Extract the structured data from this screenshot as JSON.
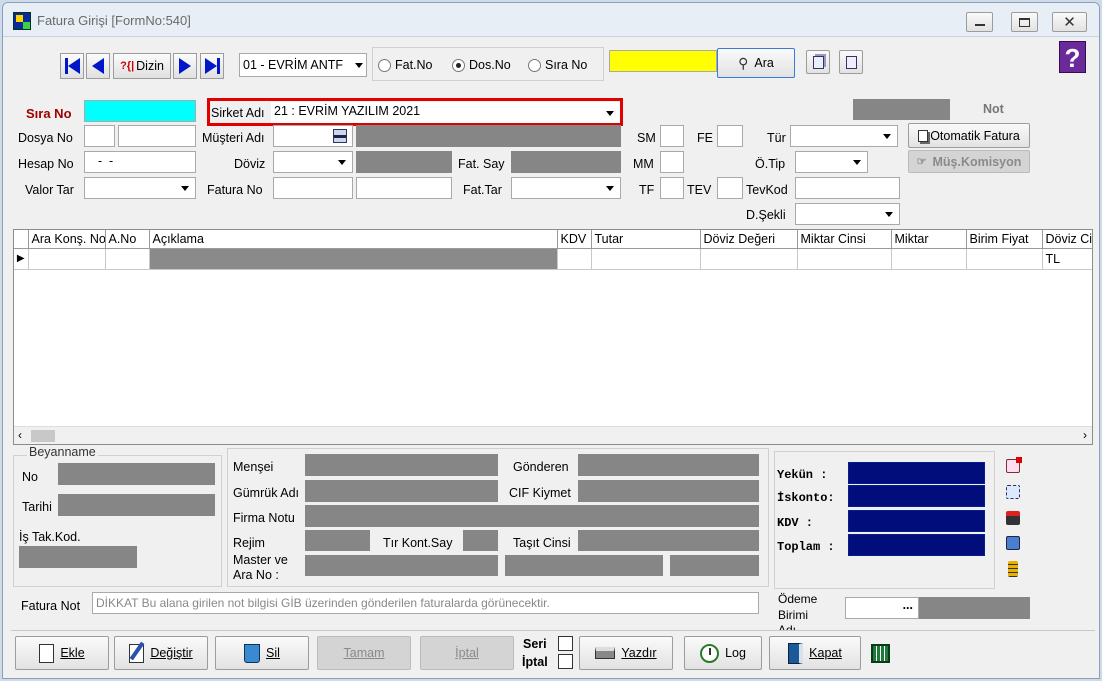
{
  "title": "Fatura Girişi [FormNo:540]",
  "nav": {
    "dizin": "Dizin",
    "company_select": "01 - EVRİM ANTF",
    "radio_fatno": "Fat.No",
    "radio_dosno": "Dos.No",
    "radio_sirano": "Sıra No",
    "ara": "Ara",
    "selected_radio": "Dos.No"
  },
  "header": {
    "sira_no": "Sıra No",
    "sirket_adi": "Sirket Adı",
    "sirket_value": "21 : EVRİM YAZILIM  2021",
    "not": "Not",
    "dosya_no": "Dosya No",
    "musteri_adi": "Müşteri Adı",
    "sm": "SM",
    "fe": "FE",
    "tur": "Tür",
    "otomatik_fatura": "Otomatik Fatura",
    "hesap_no": "Hesap No",
    "hesap_no_value": "  -  -  ",
    "doviz": "Döviz",
    "fat_say": "Fat. Say",
    "mm": "MM",
    "o_tip": "Ö.Tip",
    "mus_komisyon": "Müş.Komisyon",
    "valor_tar": "Valor Tar",
    "fatura_no": "Fatura No",
    "fat_tar": "Fat.Tar",
    "tf": "TF",
    "tev": "TEV",
    "tevkod": "TevKod",
    "d_sekli": "D.Şekli"
  },
  "grid": {
    "columns": [
      "Ara Konş. No",
      "A.No",
      "Açıklama",
      "KDV",
      "Tutar",
      "Döviz Değeri",
      "Miktar Cinsi",
      "Miktar",
      "Birim Fiyat",
      "Döviz Ci"
    ],
    "row": {
      "doviz": "TL"
    }
  },
  "beyanname": {
    "title": "Beyanname",
    "no": "No",
    "tarihi": "Tarihi",
    "is_tak_kod": "İş Tak.Kod."
  },
  "details": {
    "mensei": "Menşei",
    "gonderen": "Gönderen",
    "gumruk_adi": "Gümrük Adı",
    "cif_kiymet": "CIF Kiymet",
    "firma_notu": "Firma Notu",
    "rejim": "Rejim",
    "tir_kont_say": "Tır Kont.Say",
    "tasit_cinsi": "Taşıt Cinsi",
    "master_ve": "Master ve",
    "ara_no": "Ara No :"
  },
  "totals": {
    "yekun": "Yekün  :",
    "iskonto": "İskonto:",
    "kdv": "KDV    :",
    "toplam": "Toplam :"
  },
  "fatura_not": {
    "label": "Fatura Not",
    "value": "DİKKAT Bu alana girilen not bilgisi GİB üzerinden gönderilen faturalarda görünecektir."
  },
  "odeme": {
    "line1": "Ödeme",
    "line2": "Birimi",
    "line3": "Adı",
    "btn": "..."
  },
  "footer": {
    "ekle": "Ekle",
    "degistir": "Değiştir",
    "sil": "Sil",
    "tamam": "Tamam",
    "iptal": "İptal",
    "seri": "Seri",
    "iptal_chk": "İptal",
    "yazdir": "Yazdır",
    "log": "Log",
    "kapat": "Kapat"
  },
  "colors": {
    "sira_no_field": "#00ffff",
    "search_field": "#ffff00",
    "highlight": "#e00000",
    "totals_field": "#000d7a",
    "label_red": "#a00000"
  }
}
